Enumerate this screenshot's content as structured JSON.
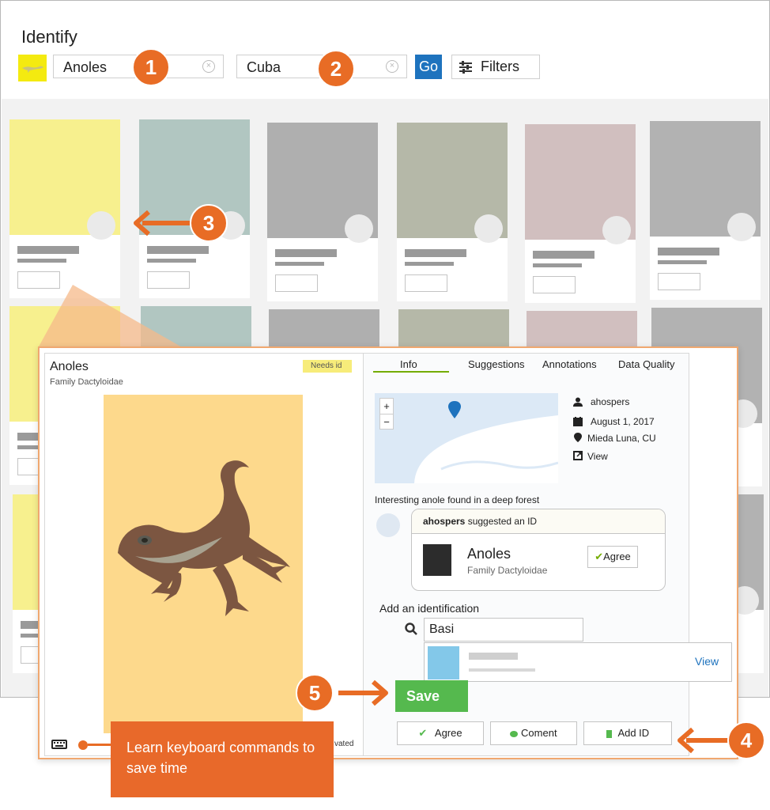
{
  "header": {
    "title": "Identify",
    "taxon_search_value": "Anoles",
    "place_search_value": "Cuba",
    "go_label": "Go",
    "filters_label": "Filters"
  },
  "grid": {
    "row1_photo_colors": [
      "#f7f08e",
      "#b1c6c1",
      "#afafaf",
      "#b5b8a8",
      "#d1bfbf",
      "#b2b2b2"
    ],
    "row2_photo_colors": [
      "#f7f08e",
      "#b1c6c1",
      "#afafaf",
      "#b5b8a8",
      "#d1bfbf",
      "#b2b2b2"
    ]
  },
  "callouts": {
    "badge_1": "1",
    "badge_2": "2",
    "badge_3": "3",
    "badge_4": "4",
    "badge_5": "5",
    "tooltip_text": "Learn keyboard commands to save time",
    "accent_color": "#e86c25"
  },
  "modal": {
    "taxon_name": "Anoles",
    "taxon_family": "Family Dactyloidae",
    "status_badge": "Needs id",
    "footer_partial_text": "vated",
    "tabs": [
      "Info",
      "Suggestions",
      "Annotations",
      "Data Quality"
    ],
    "map": {
      "zoom_in": "+",
      "zoom_out": "−"
    },
    "meta": {
      "user": "ahospers",
      "date": "August 1, 2017",
      "place": "Mieda Luna, CU",
      "view": "View"
    },
    "description": "Interesting anole found in a deep forest",
    "suggestion": {
      "user": "ahospers",
      "suffix": " suggested an ID",
      "taxon": "Anoles",
      "family": "Family Dactyloidae",
      "agree_label": "Agree"
    },
    "add_identification": {
      "label": "Add an identification",
      "input_value": "Basi",
      "result_view_label": "View"
    },
    "save_label": "Save",
    "actions": {
      "agree_label": "Agree",
      "comment_label": "Coment",
      "add_id_label": "Add ID"
    }
  }
}
